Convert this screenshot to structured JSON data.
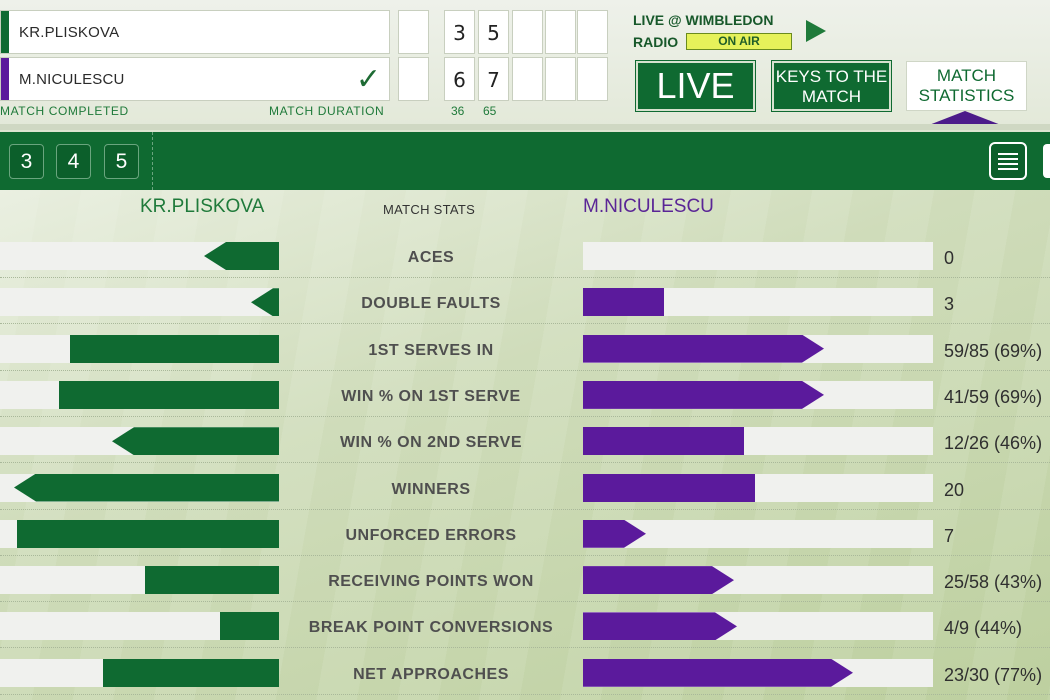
{
  "scoreboard": {
    "player1": {
      "name": "KR.PLISKOVA",
      "color": "#0f6a31",
      "sets": [
        "3",
        "5"
      ]
    },
    "player2": {
      "name": "M.NICULESCU",
      "color": "#5b1a9c",
      "sets": [
        "6",
        "7"
      ],
      "winner": true
    },
    "status_label": "MATCH COMPLETED",
    "duration_label": "MATCH DURATION",
    "durations": [
      "36",
      "65"
    ]
  },
  "radio": {
    "title": "LIVE @ WIMBLEDON",
    "label": "RADIO",
    "badge": "ON AIR",
    "play_icon": "play-icon"
  },
  "nav_buttons": {
    "live": "LIVE",
    "keys_line1": "KEYS TO THE",
    "keys_line2": "MATCH",
    "stats_line1": "MATCH",
    "stats_line2": "STATISTICS"
  },
  "set_tabs": [
    "3",
    "4",
    "5"
  ],
  "stats_header": {
    "left": "KR.PLISKOVA",
    "middle": "MATCH STATS",
    "right": "M.NICULESCU"
  },
  "stats": [
    {
      "label": "ACES",
      "left_fraction": 0.27,
      "right_fraction": 0.0,
      "right_value": "0",
      "left_arrow": true,
      "right_arrow": false
    },
    {
      "label": "DOUBLE FAULTS",
      "left_fraction": 0.1,
      "right_fraction": 0.23,
      "right_value": "3",
      "left_arrow": true,
      "right_arrow": false
    },
    {
      "label": "1ST SERVES IN",
      "left_fraction": 0.75,
      "right_fraction": 0.69,
      "right_value": "59/85 (69%)",
      "left_arrow": false,
      "right_arrow": true
    },
    {
      "label": "WIN % ON 1ST SERVE",
      "left_fraction": 0.79,
      "right_fraction": 0.69,
      "right_value": "41/59 (69%)",
      "left_arrow": false,
      "right_arrow": true
    },
    {
      "label": "WIN % ON 2ND SERVE",
      "left_fraction": 0.6,
      "right_fraction": 0.46,
      "right_value": "12/26 (46%)",
      "left_arrow": true,
      "right_arrow": false
    },
    {
      "label": "WINNERS",
      "left_fraction": 0.95,
      "right_fraction": 0.49,
      "right_value": "20",
      "left_arrow": true,
      "right_arrow": false
    },
    {
      "label": "UNFORCED ERRORS",
      "left_fraction": 0.94,
      "right_fraction": 0.18,
      "right_value": "7",
      "left_arrow": false,
      "right_arrow": true
    },
    {
      "label": "RECEIVING POINTS WON",
      "left_fraction": 0.48,
      "right_fraction": 0.43,
      "right_value": "25/58 (43%)",
      "left_arrow": false,
      "right_arrow": true
    },
    {
      "label": "BREAK POINT CONVERSIONS",
      "left_fraction": 0.21,
      "right_fraction": 0.44,
      "right_value": "4/9 (44%)",
      "left_arrow": false,
      "right_arrow": true
    },
    {
      "label": "NET APPROACHES",
      "left_fraction": 0.63,
      "right_fraction": 0.77,
      "right_value": "23/30 (77%)",
      "left_arrow": false,
      "right_arrow": true
    }
  ]
}
